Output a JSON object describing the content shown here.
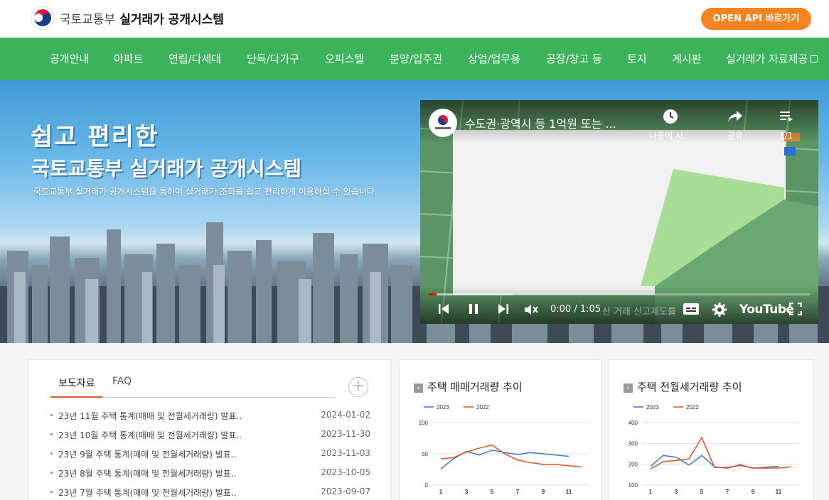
{
  "header": {
    "org_name": "국토교통부",
    "system_name": "실거래가 공개시스템",
    "api_button": "OPEN API 바로가기"
  },
  "nav": {
    "items": [
      {
        "label": "공개안내"
      },
      {
        "label": "아파트"
      },
      {
        "label": "연립/다세대"
      },
      {
        "label": "단독/다가구"
      },
      {
        "label": "오피스텔"
      },
      {
        "label": "분양/입주권"
      },
      {
        "label": "상업/업무용"
      },
      {
        "label": "공장/창고 등"
      },
      {
        "label": "토지"
      },
      {
        "label": "게시판"
      },
      {
        "label": "실거래가 자료제공"
      }
    ]
  },
  "hero": {
    "title_line1": "쉽고 편리한",
    "title_line2": "국토교통부 실거래가 공개시스템",
    "description": "국토교통부 실거래가 공개시스템을 통하여 실거래가 조회를 쉽고 편리하게 이용하실 수 있습니다."
  },
  "video": {
    "title": "수도권·광역시 등 1억원 또는 ...",
    "watch_later": "나중에 시...",
    "share": "공유",
    "playlist_count": "1/1",
    "time": "0:00 / 1:05",
    "subtitle_fragment": "산 거래 신고제도를",
    "brand": "YouTube",
    "progress_fraction": 0.02,
    "buffer_fraction": 0.22,
    "colors": {
      "play_red": "#ff0000"
    }
  },
  "news": {
    "tabs": [
      {
        "label": "보도자료",
        "active": true
      },
      {
        "label": "FAQ",
        "active": false
      }
    ],
    "more": "+",
    "items": [
      {
        "title": "23년 11월 주택 통계(매매 및 전월세거래량) 발표..",
        "date": "2024-01-02"
      },
      {
        "title": "23년 10월 주택 통계(매매 및 전월세거래량) 발표..",
        "date": "2023-11-30"
      },
      {
        "title": "23년 9월 주택 통계(매매 및 전월세거래량) 발표..",
        "date": "2023-11-03"
      },
      {
        "title": "23년 8월 주택 통계(매매 및 전월세거래량) 발표..",
        "date": "2023-10-05"
      },
      {
        "title": "23년 7월 주택 통계(매매 및 전월세거래량) 발표..",
        "date": "2023-09-07"
      }
    ]
  },
  "chart_data": [
    {
      "type": "line",
      "title": "주택 매매거래량 추이",
      "x": [
        1,
        2,
        3,
        4,
        5,
        6,
        7,
        8,
        9,
        10,
        11,
        12
      ],
      "xticks": [
        1,
        3,
        5,
        7,
        9,
        11
      ],
      "yticks": [
        0,
        50,
        100
      ],
      "ylim": [
        0,
        100
      ],
      "legend": "top-left",
      "series": [
        {
          "name": "2023",
          "color": "#3a78c7",
          "values": [
            26,
            42,
            54,
            48,
            56,
            52,
            49,
            52,
            50,
            48,
            46
          ]
        },
        {
          "name": "2022",
          "color": "#e0501e",
          "values": [
            42,
            44,
            53,
            59,
            64,
            50,
            40,
            36,
            33,
            33,
            31,
            29
          ]
        }
      ]
    },
    {
      "type": "line",
      "title": "주택 전월세거래량 추이",
      "x": [
        1,
        2,
        3,
        4,
        5,
        6,
        7,
        8,
        9,
        10,
        11,
        12
      ],
      "xticks": [
        1,
        3,
        5,
        7,
        9,
        11
      ],
      "yticks": [
        100,
        200,
        300,
        400
      ],
      "ylim": [
        100,
        400
      ],
      "legend": "top-left",
      "series": [
        {
          "name": "2023",
          "color": "#3a78c7",
          "values": [
            190,
            242,
            234,
            196,
            242,
            188,
            181,
            198,
            181,
            186,
            190
          ]
        },
        {
          "name": "2022",
          "color": "#e0501e",
          "values": [
            178,
            213,
            218,
            226,
            328,
            185,
            185,
            195,
            182,
            182,
            182,
            188
          ]
        }
      ]
    }
  ],
  "colors": {
    "nav_green": "#3ab35a",
    "api_orange": "#f5831f",
    "tab_accent": "#e05a2a"
  }
}
